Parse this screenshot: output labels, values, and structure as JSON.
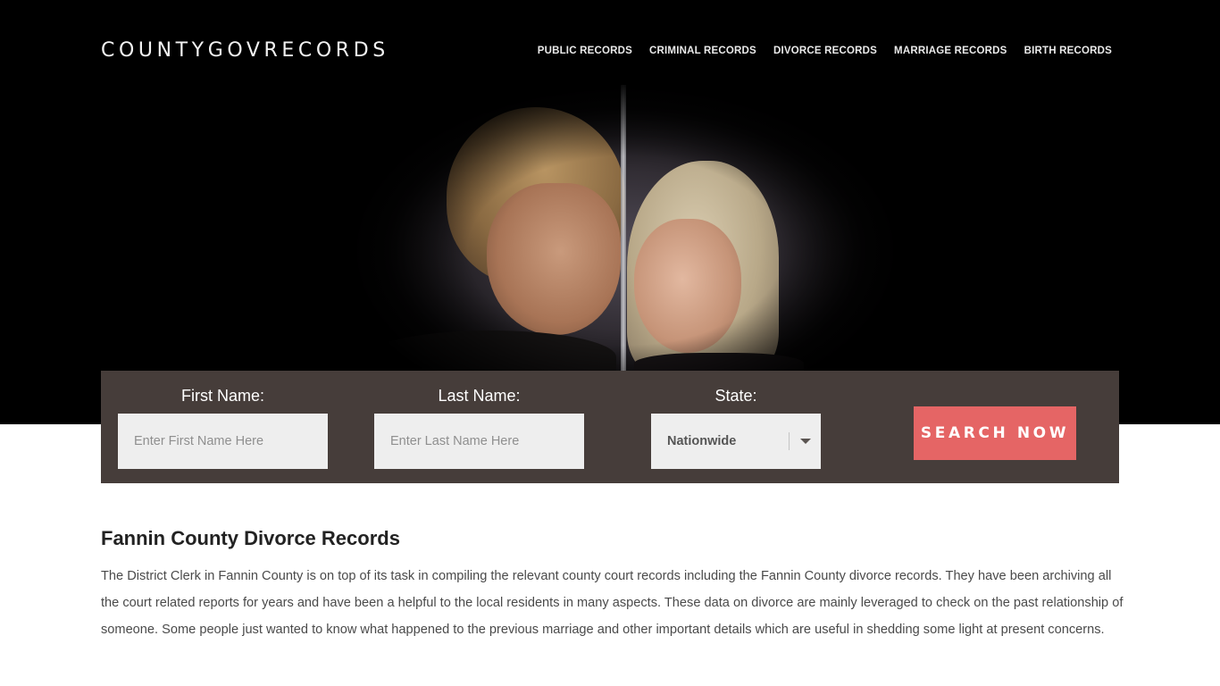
{
  "site": {
    "logo": "COUNTYGOVRECORDS"
  },
  "nav": {
    "items": [
      {
        "label": "PUBLIC RECORDS"
      },
      {
        "label": "CRIMINAL RECORDS"
      },
      {
        "label": "DIVORCE RECORDS"
      },
      {
        "label": "MARRIAGE RECORDS"
      },
      {
        "label": "BIRTH RECORDS"
      }
    ]
  },
  "hero": {
    "image_subject": "couple-leaning-on-wall-photo"
  },
  "search": {
    "first_name_label": "First Name:",
    "first_name_placeholder": "Enter First Name Here",
    "first_name_value": "",
    "last_name_label": "Last Name:",
    "last_name_placeholder": "Enter Last Name Here",
    "last_name_value": "",
    "state_label": "State:",
    "state_selected": "Nationwide",
    "submit_label": "SEARCH NOW",
    "submit_color": "#e56565",
    "panel_color": "#463d3a"
  },
  "article": {
    "title": "Fannin County Divorce Records",
    "body": "The District Clerk in Fannin County is on top of its task in compiling the relevant county court records including the Fannin County divorce records. They have been archiving all the court related reports for years and have been a helpful to the local residents in many aspects. These data on divorce are mainly leveraged to check on the past relationship of someone. Some people just wanted to know what happened to the previous marriage and other important details which are useful in shedding some light at present concerns."
  }
}
